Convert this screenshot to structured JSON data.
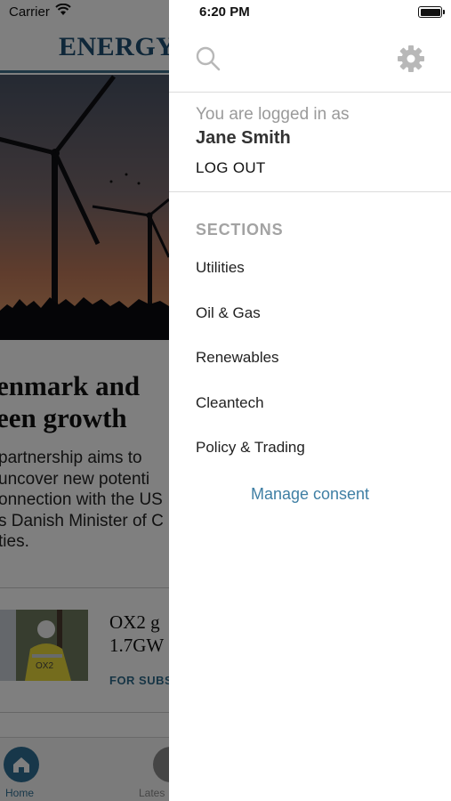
{
  "background_app": {
    "carrier": "Carrier",
    "brand": "ENERGY",
    "headline_line1": "enmark and",
    "headline_line2": "een growth",
    "summary_lines": [
      " partnership aims to",
      " uncover new potenti",
      "onnection with the US",
      "s Danish Minister of C",
      "ties."
    ],
    "card_title_line1": "OX2 g",
    "card_title_line2": "1.7GW",
    "card_tag": "FOR SUBS",
    "tabs": {
      "home": "Home",
      "latest": "Lates"
    },
    "colors": {
      "accent": "#2e6f94",
      "brand": "#1f4f73"
    }
  },
  "status_bar": {
    "time": "6:20 PM"
  },
  "menu": {
    "toolbar": {
      "search_icon": "search-icon",
      "settings_icon": "gear-icon"
    },
    "account": {
      "logged_in_label": "You are logged in as",
      "user_name": "Jane Smith",
      "logout_label": "LOG OUT"
    },
    "sections_title": "SECTIONS",
    "sections": [
      {
        "label": "Utilities"
      },
      {
        "label": "Oil & Gas"
      },
      {
        "label": "Renewables"
      },
      {
        "label": "Cleantech"
      },
      {
        "label": "Policy & Trading"
      }
    ],
    "manage_consent": "Manage consent",
    "colors": {
      "link": "#3f7fa4",
      "muted": "#a3a3a3"
    }
  }
}
